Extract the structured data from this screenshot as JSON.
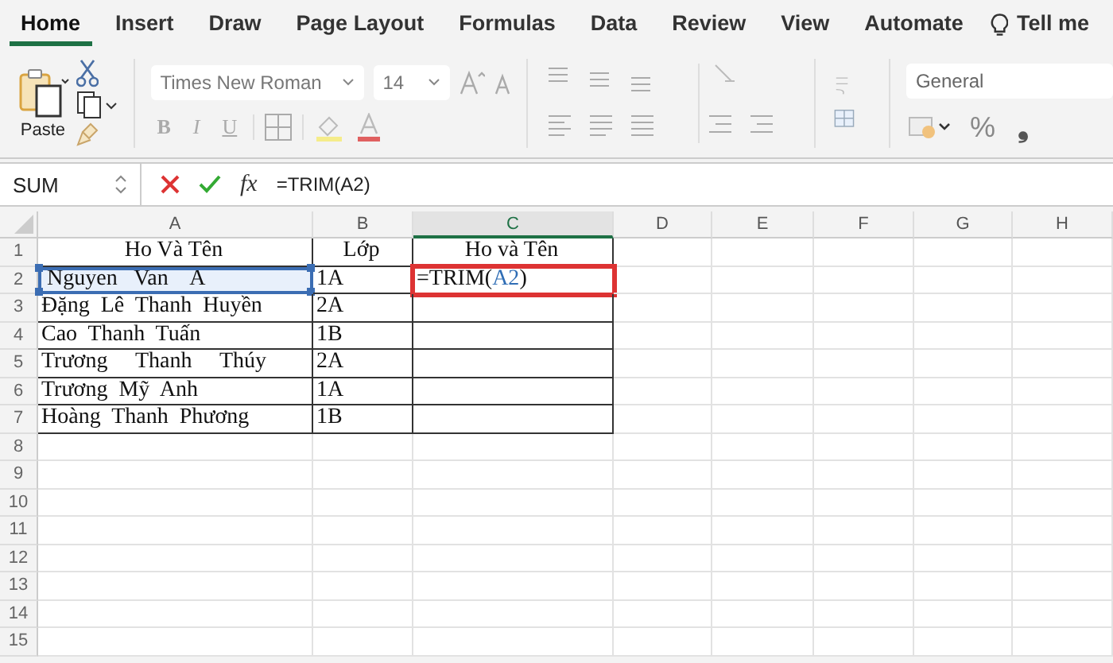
{
  "tabs": [
    {
      "label": "Home",
      "selected": true
    },
    {
      "label": "Insert",
      "selected": false
    },
    {
      "label": "Draw",
      "selected": false
    },
    {
      "label": "Page Layout",
      "selected": false
    },
    {
      "label": "Formulas",
      "selected": false
    },
    {
      "label": "Data",
      "selected": false
    },
    {
      "label": "Review",
      "selected": false
    },
    {
      "label": "View",
      "selected": false
    },
    {
      "label": "Automate",
      "selected": false
    }
  ],
  "tell_me": "Tell me",
  "ribbon": {
    "paste": "Paste",
    "font_name": "Times New Roman",
    "font_size": "14",
    "bold": "B",
    "italic": "I",
    "underline": "U",
    "number_format": "General",
    "percent": "%",
    "comma": "❟"
  },
  "formula_bar": {
    "name_box": "SUM",
    "fx": "fx",
    "formula": "=TRIM(A2)"
  },
  "columns": [
    {
      "label": "A",
      "selected": false
    },
    {
      "label": "B",
      "selected": false
    },
    {
      "label": "C",
      "selected": true
    },
    {
      "label": "D",
      "selected": false
    },
    {
      "label": "E",
      "selected": false
    },
    {
      "label": "F",
      "selected": false
    },
    {
      "label": "G",
      "selected": false
    },
    {
      "label": "H",
      "selected": false
    }
  ],
  "rows": [
    {
      "label": "1",
      "cells": [
        {
          "text": "Ho Và Tên",
          "selected": false,
          "editing": false
        },
        {
          "text": "Lớp",
          "selected": false,
          "editing": false
        },
        {
          "text": "Ho và Tên",
          "selected": false,
          "editing": false
        }
      ]
    },
    {
      "label": "2",
      "cells": [
        {
          "text": " Nguyen   Van    A",
          "selected": true,
          "editing": false
        },
        {
          "text": "1A",
          "selected": false,
          "editing": false
        },
        {
          "parts": [
            {
              "text": "=TRIM(",
              "kind": "plain"
            },
            {
              "text": "A2",
              "kind": "ref"
            },
            {
              "text": ")",
              "kind": "plain"
            }
          ],
          "selected": false,
          "editing": true
        }
      ]
    },
    {
      "label": "3",
      "cells": [
        {
          "text": "Đặng  Lê  Thanh  Huyền",
          "selected": false,
          "editing": false
        },
        {
          "text": "2A",
          "selected": false,
          "editing": false
        },
        {
          "selected": false,
          "editing": false
        }
      ]
    },
    {
      "label": "4",
      "cells": [
        {
          "text": "Cao  Thanh  Tuấn",
          "selected": false,
          "editing": false
        },
        {
          "text": "1B",
          "selected": false,
          "editing": false
        },
        {
          "selected": false,
          "editing": false
        }
      ]
    },
    {
      "label": "5",
      "cells": [
        {
          "text": "Trương     Thanh     Thúy",
          "selected": false,
          "editing": false
        },
        {
          "text": "2A",
          "selected": false,
          "editing": false
        },
        {
          "selected": false,
          "editing": false
        }
      ]
    },
    {
      "label": "6",
      "cells": [
        {
          "text": "Trương  Mỹ  Anh",
          "selected": false,
          "editing": false
        },
        {
          "text": "1A",
          "selected": false,
          "editing": false
        },
        {
          "selected": false,
          "editing": false
        }
      ]
    },
    {
      "label": "7",
      "cells": [
        {
          "text": "Hoàng  Thanh  Phương",
          "selected": false,
          "editing": false
        },
        {
          "text": "1B",
          "selected": false,
          "editing": false
        },
        {
          "selected": false,
          "editing": false
        }
      ]
    },
    {
      "label": "8"
    },
    {
      "label": "9"
    },
    {
      "label": "10"
    },
    {
      "label": "11"
    },
    {
      "label": "12"
    },
    {
      "label": "13"
    },
    {
      "label": "14"
    },
    {
      "label": "15"
    }
  ]
}
